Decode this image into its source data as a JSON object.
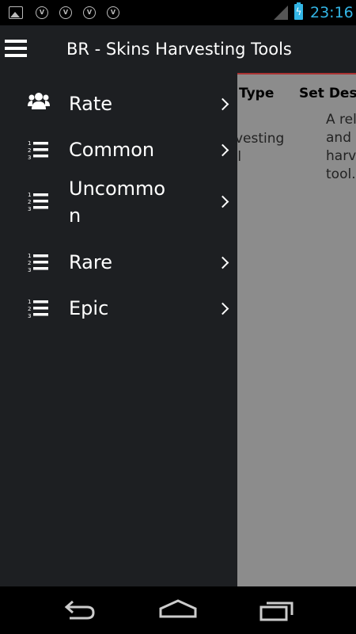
{
  "status_bar": {
    "time": "23:16",
    "icons": [
      "image-icon",
      "v-badge-icon",
      "v-badge-icon",
      "v-badge-icon",
      "v-badge-icon",
      "signal-icon",
      "battery-charging-icon"
    ]
  },
  "action_bar": {
    "title": "BR - Skins Harvesting Tools",
    "menu_icon": "hamburger-icon"
  },
  "drawer": {
    "items": [
      {
        "label": "Rate",
        "icon": "users-icon"
      },
      {
        "label": "Common",
        "icon": "numbered-list-icon"
      },
      {
        "label": "Uncommo\nn",
        "icon": "numbered-list-icon"
      },
      {
        "label": "Rare",
        "icon": "numbered-list-icon"
      },
      {
        "label": "Epic",
        "icon": "numbered-list-icon"
      }
    ]
  },
  "content": {
    "columns": [
      "Type",
      "Set Desc"
    ],
    "row": {
      "type": "rvesting\nol",
      "description": "A rel\nand \nharv\ntool."
    }
  },
  "nav_bar": {
    "buttons": [
      "back-icon",
      "home-icon",
      "recent-apps-icon"
    ]
  },
  "colors": {
    "accent": "#33b5e5",
    "drawer_bg": "#1d1f22",
    "content_bg": "#8c8c8c",
    "divider": "#aa3333"
  }
}
